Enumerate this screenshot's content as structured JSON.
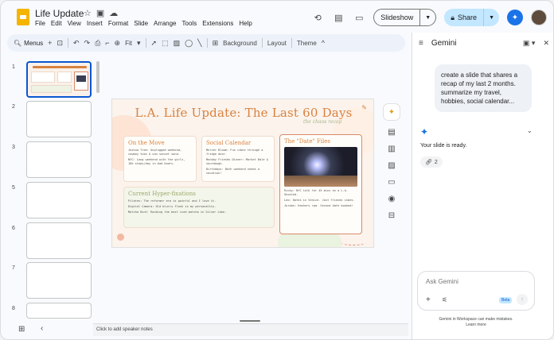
{
  "doc": {
    "title": "Life Update",
    "menu": [
      "File",
      "Edit",
      "View",
      "Insert",
      "Format",
      "Slide",
      "Arrange",
      "Tools",
      "Extensions",
      "Help"
    ]
  },
  "header": {
    "slideshow_label": "Slideshow",
    "share_label": "Share"
  },
  "toolbar": {
    "menus_label": "Menus",
    "zoom_label": "Fit",
    "background_label": "Background",
    "layout_label": "Layout",
    "theme_label": "Theme"
  },
  "filmstrip": {
    "numbers": [
      "1",
      "2",
      "3",
      "5",
      "6",
      "7",
      "8"
    ]
  },
  "slide": {
    "title": "L.A. Life Update: The Last 60 Days",
    "subtitle": "the chaos recap",
    "move": {
      "heading": "On the Move",
      "lines": [
        "Joshua Tree: Unplugged weekend, cowboy tubs & van sunset sona.",
        "NYC: Long weekend with the girls, 10k steps/day in bad boots."
      ]
    },
    "social": {
      "heading": "Social Calendar",
      "lines": [
        "Mercer Bloom: Fun vibes through a fridge door.",
        "Monday Friends Dinner: Market Bale & sourdough.",
        "Birthdays: Both weekend needs a vacation!"
      ]
    },
    "date": {
      "heading": "The \"Date\" Files",
      "lines": [
        "Ricky: NYC talk for 45 mins on a L.A. Ghosted.",
        "Leo: Dates in Venice. Just friends vibes.",
        "Jordan: Hashers rpm. Second date booked!"
      ]
    },
    "hyper": {
      "heading": "Current Hyper-fixations",
      "lines": [
        "Pilates: The reformer era is painful and I love it.",
        "Digital Camera: Old blurry flash is my personality.",
        "Matcha Hunt: Ranking the best iced matcha in Silver Lake."
      ]
    }
  },
  "notes": {
    "placeholder": "Click to add speaker notes"
  },
  "gemini": {
    "title": "Gemini",
    "user_message": "create a slide that shares a recap of my last 2 months. summarize my travel, hobbies, social calendar...",
    "reply": "Your slide is ready.",
    "source_count": "2",
    "ask_placeholder": "Ask Gemini",
    "beta_label": "Beta",
    "disclaimer": "Gemini in Workspace can make mistakes.",
    "learn_more": "Learn more"
  },
  "colors": {
    "accent": "#0b57d0",
    "slide_title": "#d9823f",
    "share_bg": "#c2e7ff"
  },
  "icons": [
    "star-icon",
    "move-to-folder-icon",
    "cloud-status-icon",
    "history-icon",
    "comment-icon",
    "camera-icon",
    "lock-icon",
    "gemini-spark-icon",
    "search-icon",
    "undo-icon",
    "redo-icon",
    "print-icon",
    "paint-format-icon",
    "zoom-icon",
    "cursor-icon",
    "select-icon",
    "image-icon",
    "shape-icon",
    "line-icon",
    "comment-add-icon",
    "collapse-icon",
    "grid-view-icon",
    "menu-icon",
    "panel-icon",
    "close-icon",
    "link-icon",
    "plus-icon",
    "tune-icon",
    "send-icon"
  ]
}
